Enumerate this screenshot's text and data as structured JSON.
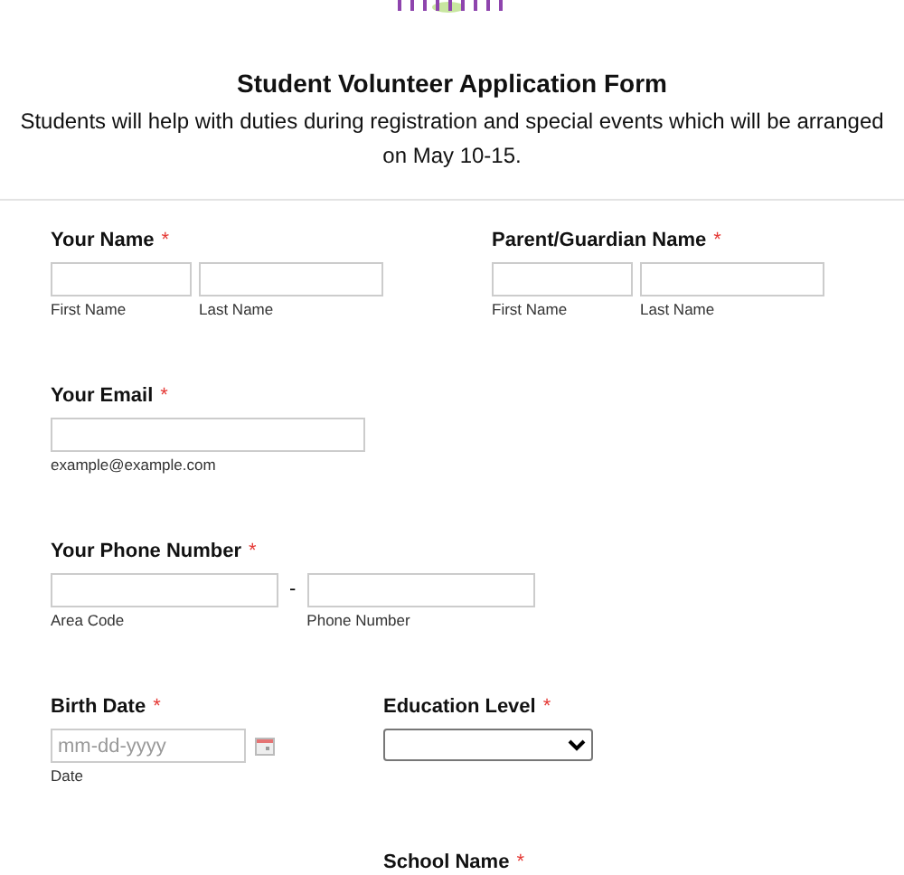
{
  "header": {
    "title": "Student Volunteer Application Form",
    "description": "Students will help with duties during registration and special events which will be arranged on May 10-15."
  },
  "rows": [
    {
      "fields": [
        {
          "kind": "name",
          "label": "Your Name",
          "required_mark": "*",
          "inputs": [
            {
              "sublabel": "First Name"
            },
            {
              "sublabel": "Last Name"
            }
          ]
        },
        {
          "kind": "name",
          "label": "Parent/Guardian Name",
          "required_mark": "*",
          "inputs": [
            {
              "sublabel": "First Name"
            },
            {
              "sublabel": "Last Name"
            }
          ]
        }
      ]
    },
    {
      "fields": [
        {
          "kind": "email",
          "label": "Your Email",
          "required_mark": "*",
          "inputs": [
            {
              "sublabel": "example@example.com"
            }
          ]
        }
      ]
    },
    {
      "fields": [
        {
          "kind": "phone",
          "label": "Your Phone Number",
          "required_mark": "*",
          "separator": "-",
          "inputs": [
            {
              "sublabel": "Area Code"
            },
            {
              "sublabel": "Phone Number"
            }
          ]
        }
      ]
    },
    {
      "fields": [
        {
          "kind": "date",
          "label": "Birth Date",
          "required_mark": "*",
          "inputs": [
            {
              "sublabel": "Date",
              "placeholder": "mm-dd-yyyy"
            }
          ]
        },
        {
          "kind": "select",
          "label": "Education Level",
          "required_mark": "*"
        }
      ]
    },
    {
      "fields": [
        {
          "kind": "blank"
        },
        {
          "kind": "label",
          "label": "School Name",
          "required_mark": "*"
        }
      ]
    }
  ]
}
